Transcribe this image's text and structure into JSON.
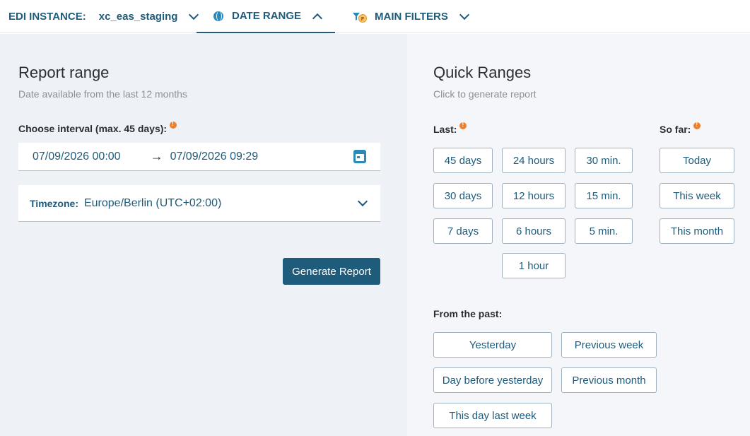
{
  "topbar": {
    "instance_label": "EDI INSTANCE:",
    "instance_value": "xc_eas_staging",
    "date_range_label": "DATE RANGE",
    "main_filters_label": "MAIN FILTERS"
  },
  "report_range": {
    "title": "Report range",
    "subtitle": "Date available from the last 12 months",
    "interval_label": "Choose interval (max. 45 days):",
    "from": "07/09/2026 00:00",
    "to": "07/09/2026 09:29",
    "arrow": "→",
    "timezone_label": "Timezone:",
    "timezone_value": "Europe/Berlin (UTC+02:00)",
    "generate_label": "Generate Report"
  },
  "quick_ranges": {
    "title": "Quick Ranges",
    "subtitle": "Click to generate report",
    "last_label": "Last:",
    "so_far_label": "So far:",
    "past_label": "From the past:",
    "last": [
      "45 days",
      "24 hours",
      "30 min.",
      "30 days",
      "12 hours",
      "15 min.",
      "7 days",
      "6 hours",
      "5 min.",
      "1 hour"
    ],
    "so_far": [
      "Today",
      "This week",
      "This month"
    ],
    "past": [
      "Yesterday",
      "Previous week",
      "Day before yesterday",
      "Previous month",
      "This day last week"
    ]
  },
  "colors": {
    "accent": "#1f5b7a",
    "info": "#f07f2a",
    "left_bg": "#eef2f6",
    "right_bg": "#f4f6f9"
  }
}
